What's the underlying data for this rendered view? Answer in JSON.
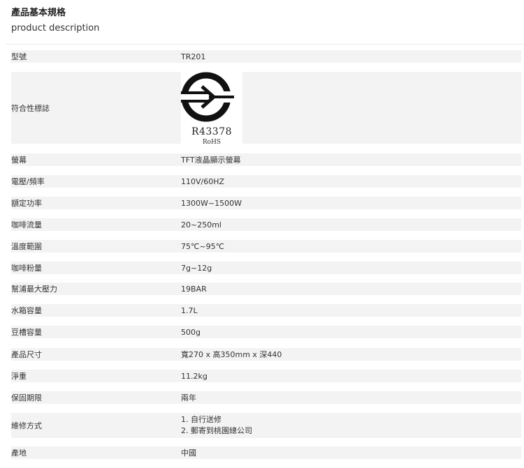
{
  "header": {
    "title": "產品基本規格",
    "subtitle": "product description"
  },
  "specs": [
    {
      "label": "型號",
      "value": "TR201"
    },
    {
      "label": "符合性標誌",
      "logo_code": "R43378",
      "logo_sub": "RoHS"
    },
    {
      "label": "螢幕",
      "value": "TFT液晶顯示螢幕"
    },
    {
      "label": "電壓/頻率",
      "value": "110V/60HZ"
    },
    {
      "label": "額定功率",
      "value": "1300W~1500W"
    },
    {
      "label": "咖啡流量",
      "value": "20~250ml"
    },
    {
      "label": "溫度範圍",
      "value": "75℃~95℃"
    },
    {
      "label": "咖啡粉量",
      "value": "7g~12g"
    },
    {
      "label": "幫浦最大壓力",
      "value": "19BAR"
    },
    {
      "label": "水箱容量",
      "value": "1.7L"
    },
    {
      "label": "豆槽容量",
      "value": "500g"
    },
    {
      "label": "產品尺寸",
      "value": "寬270 x 高350mm x 深440"
    },
    {
      "label": "淨重",
      "value": "11.2kg"
    },
    {
      "label": "保固期限",
      "value": "兩年"
    },
    {
      "label": "維修方式",
      "lines": [
        "1. 自行送修",
        "2. 郵寄到桃園總公司"
      ]
    },
    {
      "label": "產地",
      "value": "中國"
    }
  ]
}
